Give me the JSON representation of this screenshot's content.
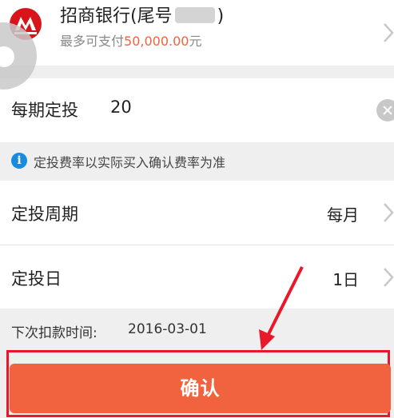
{
  "bank": {
    "name_prefix": "招商银行(尾号",
    "name_suffix": ")",
    "limit_label": "最多可支付",
    "limit_amount": "50,000.00",
    "limit_unit": "元"
  },
  "amount_field": {
    "label": "每期定投",
    "value": "20"
  },
  "notice": {
    "icon_text": "i",
    "text": "定投费率以实际买入确认费率为准"
  },
  "period": {
    "label": "定投周期",
    "value": "每月"
  },
  "day": {
    "label": "定投日",
    "value": "1日"
  },
  "next_debit": {
    "label": "下次扣款时间:",
    "date": "2016-03-01"
  },
  "confirm": {
    "label": "确认"
  },
  "colors": {
    "accent": "#f0633e",
    "info": "#1a8bdc",
    "annotation": "#e8182a",
    "bank_logo": "#d7141a"
  },
  "icons": {
    "bank_logo": "cmb-logo-icon",
    "chevron": "chevron-right-icon",
    "clear": "clear-icon",
    "info": "info-icon"
  }
}
